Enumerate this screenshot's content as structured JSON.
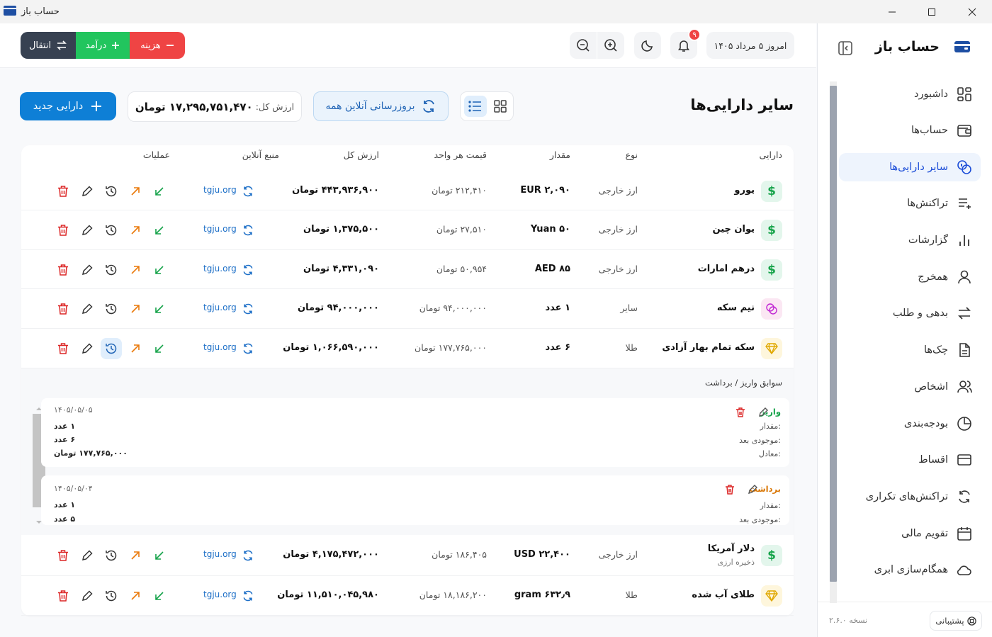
{
  "window": {
    "title": "حساب باز"
  },
  "header": {
    "expense_label": "هزینه",
    "income_label": "درآمد",
    "transfer_label": "انتقال",
    "notification_count": "۹",
    "date_text": "امروز ۵ مرداد ۱۴۰۵"
  },
  "sidebar": {
    "brand": "حساب باز",
    "items": [
      {
        "label": "داشبورد",
        "icon": "dashboard-icon"
      },
      {
        "label": "حساب‌ها",
        "icon": "wallet-icon"
      },
      {
        "label": "سایر دارایی‌ها",
        "icon": "coins-icon",
        "active": true
      },
      {
        "label": "تراکنش‌ها",
        "icon": "list-plus-icon"
      },
      {
        "label": "گزارشات",
        "icon": "bar-chart-icon"
      },
      {
        "label": "همخرج",
        "icon": "user-icon"
      },
      {
        "label": "بدهی و طلب",
        "icon": "arrows-exchange-icon"
      },
      {
        "label": "چک‌ها",
        "icon": "document-icon"
      },
      {
        "label": "اشخاص",
        "icon": "users-icon"
      },
      {
        "label": "بودجه‌بندی",
        "icon": "pie-chart-icon"
      },
      {
        "label": "اقساط",
        "icon": "credit-card-icon"
      },
      {
        "label": "تراکنش‌های تکراری",
        "icon": "repeat-icon"
      },
      {
        "label": "تقویم مالی",
        "icon": "calendar-icon"
      },
      {
        "label": "همگام‌سازی ابری",
        "icon": "cloud-icon"
      }
    ],
    "support_label": "پشتیبانی",
    "version": "نسخه ۲.۶.۰"
  },
  "page": {
    "title": "سایر دارایی‌ها",
    "refresh_all_label": "بروزرسانی آنلاین همه",
    "total_label": "ارزش کل:",
    "total_value": "۱۷,۲۹۵,۷۵۱,۴۷۰ تومان",
    "new_asset_label": "دارایی جدید"
  },
  "table": {
    "columns": [
      "دارایی",
      "نوع",
      "مقدار",
      "قیمت هر واحد",
      "ارزش کل",
      "منبع آنلاین",
      "عملیات"
    ],
    "rows": [
      {
        "name": "یورو",
        "sub": "",
        "type": "ارز خارجی",
        "amount": "EUR ۲,۰۹۰",
        "unit_price": "۲۱۲,۴۱۰ تومان",
        "total": "۴۴۳,۹۳۶,۹۰۰ تومان",
        "source": "tgju.org",
        "icon": "dollar-icon"
      },
      {
        "name": "یوان چین",
        "sub": "",
        "type": "ارز خارجی",
        "amount": "Yuan ۵۰",
        "unit_price": "۲۷,۵۱۰ تومان",
        "total": "۱,۳۷۵,۵۰۰ تومان",
        "source": "tgju.org",
        "icon": "dollar-icon"
      },
      {
        "name": "درهم امارات",
        "sub": "",
        "type": "ارز خارجی",
        "amount": "AED ۸۵",
        "unit_price": "۵۰,۹۵۴ تومان",
        "total": "۴,۳۳۱,۰۹۰ تومان",
        "source": "tgju.org",
        "icon": "dollar-icon"
      },
      {
        "name": "نیم سکه",
        "sub": "",
        "type": "سایر",
        "amount": "۱ عدد",
        "unit_price": "۹۴,۰۰۰,۰۰۰ تومان",
        "total": "۹۴,۰۰۰,۰۰۰ تومان",
        "source": "tgju.org",
        "icon": "coins-icon"
      },
      {
        "name": "سکه تمام بهار آزادی",
        "sub": "",
        "type": "طلا",
        "amount": "۶ عدد",
        "unit_price": "۱۷۷,۷۶۵,۰۰۰ تومان",
        "total": "۱,۰۶۶,۵۹۰,۰۰۰ تومان",
        "source": "tgju.org",
        "icon": "diamond-icon"
      },
      {
        "name": "دلار آمریکا",
        "sub": "ذخیره ارزی",
        "type": "ارز خارجی",
        "amount": "USD ۲۲,۴۰۰",
        "unit_price": "۱۸۶,۴۰۵ تومان",
        "total": "۴,۱۷۵,۴۷۲,۰۰۰ تومان",
        "source": "tgju.org",
        "icon": "dollar-icon"
      },
      {
        "name": "طلای آب شده",
        "sub": "",
        "type": "طلا",
        "amount": "gram ۶۳۲٫۹",
        "unit_price": "۱۸,۱۸۶,۲۰۰ تومان",
        "total": "۱۱,۵۱۰,۰۴۵,۹۸۰ تومان",
        "source": "tgju.org",
        "icon": "diamond-icon"
      }
    ]
  },
  "history": {
    "title": "سوابق واریز / برداشت",
    "entries": [
      {
        "kind": "واریز",
        "date": "۱۴۰۵/۰۵/۰۵",
        "amount_label": "مقدار:",
        "amount": "۱ عدد",
        "after_label": "موجودی بعد:",
        "after": "۶ عدد",
        "equiv_label": "معادل:",
        "equiv": "۱۷۷,۷۶۵,۰۰۰ تومان"
      },
      {
        "kind": "برداشت",
        "date": "۱۴۰۵/۰۵/۰۴",
        "amount_label": "مقدار:",
        "amount": "۱ عدد",
        "after_label": "موجودی بعد:",
        "after": "۵ عدد"
      }
    ]
  },
  "colors": {
    "accent": "#0e7fd6",
    "expense": "#ef4444",
    "income": "#22c55e",
    "transfer": "#374151",
    "deposit": "#16a34a",
    "withdraw": "#d97706"
  }
}
